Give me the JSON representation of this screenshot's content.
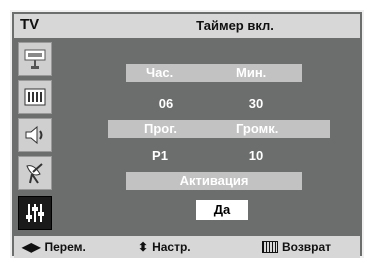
{
  "header": {
    "tv_label": "TV",
    "title": "Таймер вкл."
  },
  "sidebar": {
    "icons": [
      "input-icon",
      "picture-icon",
      "sound-icon",
      "channel-icon",
      "setup-icon"
    ],
    "active_index": 4
  },
  "fields": {
    "hour_label": "Час.",
    "minute_label": "Мин.",
    "hour_value": "06",
    "minute_value": "30",
    "program_label": "Прог.",
    "volume_label": "Громк.",
    "program_value": "P1",
    "volume_value": "10",
    "activation_label": "Активация",
    "activation_value": "Да"
  },
  "footer": {
    "move_label": "Перем.",
    "adjust_label": "Настр.",
    "return_label": "Возврат"
  }
}
